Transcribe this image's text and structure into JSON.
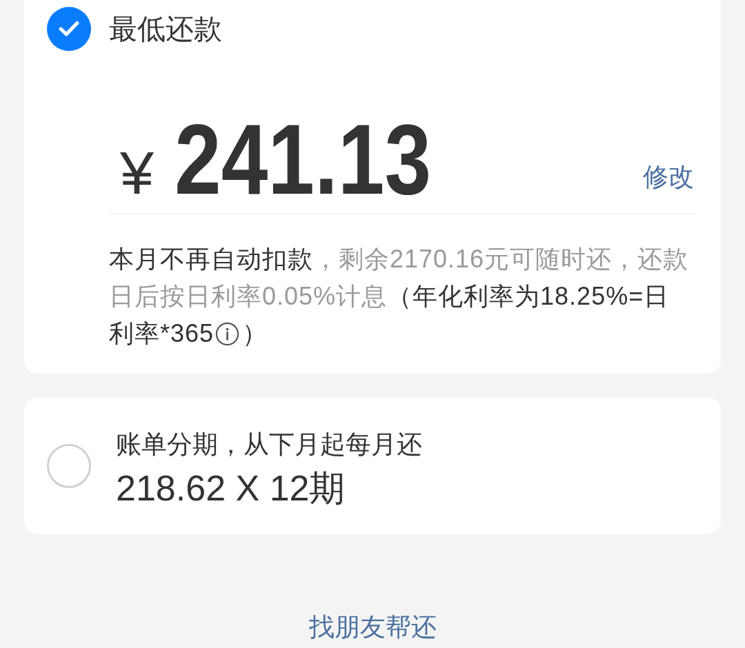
{
  "options": [
    {
      "kind": "minimum",
      "selected": true,
      "label": "最低还款",
      "currency": "¥",
      "amount": "241.13",
      "edit_link": "修改",
      "note": {
        "segments": [
          {
            "kind": "plain",
            "text": "本月不再自动扣款"
          },
          {
            "kind": "muted",
            "text": "，剩余2170.16元可随时还，还款日后按日利率0.05%计息"
          },
          {
            "kind": "plain",
            "text": "（年化利率为18.25%=日利率*365"
          }
        ],
        "closing": "）"
      }
    },
    {
      "kind": "installment",
      "selected": false,
      "title": "账单分期，从下月起每月还",
      "amount": "218.62 X 12期"
    }
  ],
  "friend_link": "找朋友帮还"
}
